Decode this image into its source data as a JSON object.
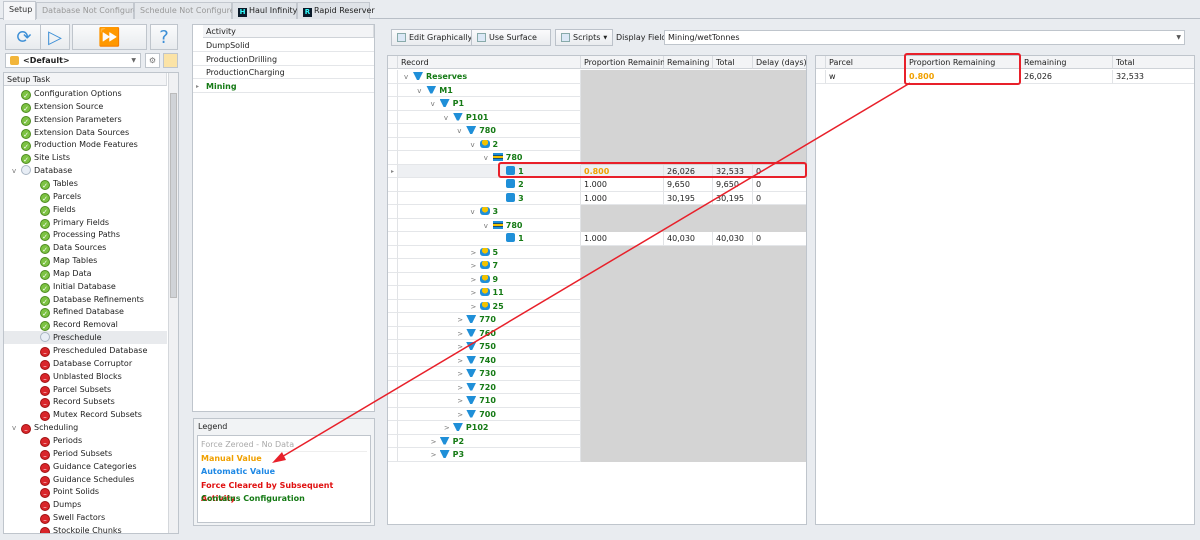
{
  "tabs": [
    {
      "label": "Setup",
      "active": true
    },
    {
      "label": "Database Not Configured"
    },
    {
      "label": "Schedule Not Configured"
    },
    {
      "label": "Haul Infinity",
      "app": "H"
    },
    {
      "label": "Rapid Reserver",
      "app": "R"
    }
  ],
  "left": {
    "profile": "<Default>",
    "header": "Setup Task",
    "items": [
      {
        "label": "Configuration Options",
        "status": "ok",
        "level": 0
      },
      {
        "label": "Extension Source",
        "status": "ok",
        "level": 0
      },
      {
        "label": "Extension Parameters",
        "status": "ok",
        "level": 0
      },
      {
        "label": "Extension Data Sources",
        "status": "ok",
        "level": 0
      },
      {
        "label": "Production Mode Features",
        "status": "ok",
        "level": 0
      },
      {
        "label": "Site Lists",
        "status": "ok",
        "level": 0
      },
      {
        "label": "Database",
        "status": "none",
        "level": 0,
        "expanded": true
      },
      {
        "label": "Tables",
        "status": "ok",
        "level": 1
      },
      {
        "label": "Parcels",
        "status": "ok",
        "level": 1
      },
      {
        "label": "Fields",
        "status": "ok",
        "level": 1
      },
      {
        "label": "Primary Fields",
        "status": "ok",
        "level": 1
      },
      {
        "label": "Processing Paths",
        "status": "ok",
        "level": 1
      },
      {
        "label": "Data Sources",
        "status": "ok",
        "level": 1
      },
      {
        "label": "Map Tables",
        "status": "ok",
        "level": 1
      },
      {
        "label": "Map Data",
        "status": "ok",
        "level": 1
      },
      {
        "label": "Initial Database",
        "status": "ok",
        "level": 1
      },
      {
        "label": "Database Refinements",
        "status": "ok",
        "level": 1
      },
      {
        "label": "Refined Database",
        "status": "ok",
        "level": 1
      },
      {
        "label": "Record Removal",
        "status": "ok",
        "level": 1
      },
      {
        "label": "Preschedule",
        "status": "none",
        "level": 1,
        "selected": true
      },
      {
        "label": "Prescheduled Database",
        "status": "no",
        "level": 1
      },
      {
        "label": "Database Corruptor",
        "status": "no",
        "level": 1
      },
      {
        "label": "Unblasted Blocks",
        "status": "no",
        "level": 1
      },
      {
        "label": "Parcel Subsets",
        "status": "no",
        "level": 1
      },
      {
        "label": "Record Subsets",
        "status": "no",
        "level": 1
      },
      {
        "label": "Mutex Record Subsets",
        "status": "no",
        "level": 1
      },
      {
        "label": "Scheduling",
        "status": "no",
        "level": 0,
        "expanded": true
      },
      {
        "label": "Periods",
        "status": "no",
        "level": 1
      },
      {
        "label": "Period Subsets",
        "status": "no",
        "level": 1
      },
      {
        "label": "Guidance Categories",
        "status": "no",
        "level": 1
      },
      {
        "label": "Guidance Schedules",
        "status": "no",
        "level": 1
      },
      {
        "label": "Point Solids",
        "status": "no",
        "level": 1
      },
      {
        "label": "Dumps",
        "status": "no",
        "level": 1
      },
      {
        "label": "Swell Factors",
        "status": "no",
        "level": 1
      },
      {
        "label": "Stockpile Chunks",
        "status": "no",
        "level": 1
      }
    ]
  },
  "activity": {
    "header": "Activity",
    "items": [
      "DumpSolid",
      "ProductionDrilling",
      "ProductionCharging",
      "Mining"
    ],
    "selected": 3
  },
  "legend": {
    "title": "Legend",
    "items": [
      {
        "label": "Force Zeroed - No Data",
        "color": "#aaaaaa"
      },
      {
        "label": "Manual Value",
        "color": "#f0a000"
      },
      {
        "label": "Automatic Value",
        "color": "#1e88e5"
      },
      {
        "label": "Force Cleared by Subsequent Activity",
        "color": "#e01010"
      },
      {
        "label": "Contains Configuration",
        "color": "#157a15"
      }
    ]
  },
  "toolbar": {
    "edit": "Edit Graphically",
    "surface": "Use Surface",
    "scripts": "Scripts",
    "display_label": "Display Field:",
    "display_value": "Mining/wetTonnes"
  },
  "grid": {
    "columns": [
      "Record",
      "Proportion Remaining",
      "Remaining",
      "Total",
      "Delay (days)"
    ],
    "rows": [
      {
        "name": "Reserves",
        "level": 0,
        "icon": "reserves",
        "exp": "v"
      },
      {
        "name": "M1",
        "level": 1,
        "icon": "mine",
        "exp": "v"
      },
      {
        "name": "P1",
        "level": 2,
        "icon": "pit",
        "exp": "v"
      },
      {
        "name": "P101",
        "level": 3,
        "icon": "pit",
        "exp": "v"
      },
      {
        "name": "780",
        "level": 4,
        "icon": "pit",
        "exp": "v"
      },
      {
        "name": "2",
        "level": 5,
        "icon": "blast",
        "exp": "v"
      },
      {
        "name": "780",
        "level": 6,
        "icon": "bench",
        "exp": "v"
      },
      {
        "name": "1",
        "level": 7,
        "icon": "block",
        "leaf": true,
        "prop": "0.800",
        "manual": true,
        "rem": "26,026",
        "tot": "32,533",
        "delay": "0",
        "highlight": true
      },
      {
        "name": "2",
        "level": 7,
        "icon": "block",
        "leaf": true,
        "prop": "1.000",
        "rem": "9,650",
        "tot": "9,650",
        "delay": "0"
      },
      {
        "name": "3",
        "level": 7,
        "icon": "block",
        "leaf": true,
        "prop": "1.000",
        "rem": "30,195",
        "tot": "30,195",
        "delay": "0"
      },
      {
        "name": "3",
        "level": 5,
        "icon": "blast",
        "exp": "v"
      },
      {
        "name": "780",
        "level": 6,
        "icon": "bench",
        "exp": "v"
      },
      {
        "name": "1",
        "level": 7,
        "icon": "block",
        "leaf": true,
        "prop": "1.000",
        "rem": "40,030",
        "tot": "40,030",
        "delay": "0"
      },
      {
        "name": "5",
        "level": 5,
        "icon": "blast",
        "exp": ">"
      },
      {
        "name": "7",
        "level": 5,
        "icon": "blast",
        "exp": ">"
      },
      {
        "name": "9",
        "level": 5,
        "icon": "blast",
        "exp": ">"
      },
      {
        "name": "11",
        "level": 5,
        "icon": "blast",
        "exp": ">"
      },
      {
        "name": "25",
        "level": 5,
        "icon": "blast",
        "exp": ">"
      },
      {
        "name": "770",
        "level": 4,
        "icon": "pit",
        "exp": ">"
      },
      {
        "name": "760",
        "level": 4,
        "icon": "pit",
        "exp": ">"
      },
      {
        "name": "750",
        "level": 4,
        "icon": "pit",
        "exp": ">"
      },
      {
        "name": "740",
        "level": 4,
        "icon": "pit",
        "exp": ">"
      },
      {
        "name": "730",
        "level": 4,
        "icon": "pit",
        "exp": ">"
      },
      {
        "name": "720",
        "level": 4,
        "icon": "pit",
        "exp": ">"
      },
      {
        "name": "710",
        "level": 4,
        "icon": "pit",
        "exp": ">"
      },
      {
        "name": "700",
        "level": 4,
        "icon": "pit",
        "exp": ">"
      },
      {
        "name": "P102",
        "level": 3,
        "icon": "pit",
        "exp": ">"
      },
      {
        "name": "P2",
        "level": 2,
        "icon": "pit",
        "exp": ">"
      },
      {
        "name": "P3",
        "level": 2,
        "icon": "pit",
        "exp": ">"
      }
    ]
  },
  "parcels": {
    "columns": [
      "Parcel",
      "Proportion Remaining",
      "Remaining",
      "Total"
    ],
    "rows": [
      {
        "parcel": "w",
        "prop": "0.800",
        "rem": "26,026",
        "tot": "32,533"
      }
    ]
  },
  "colors": {
    "accent_red": "#e8202a",
    "manual": "#f0a000",
    "config": "#157a15"
  }
}
